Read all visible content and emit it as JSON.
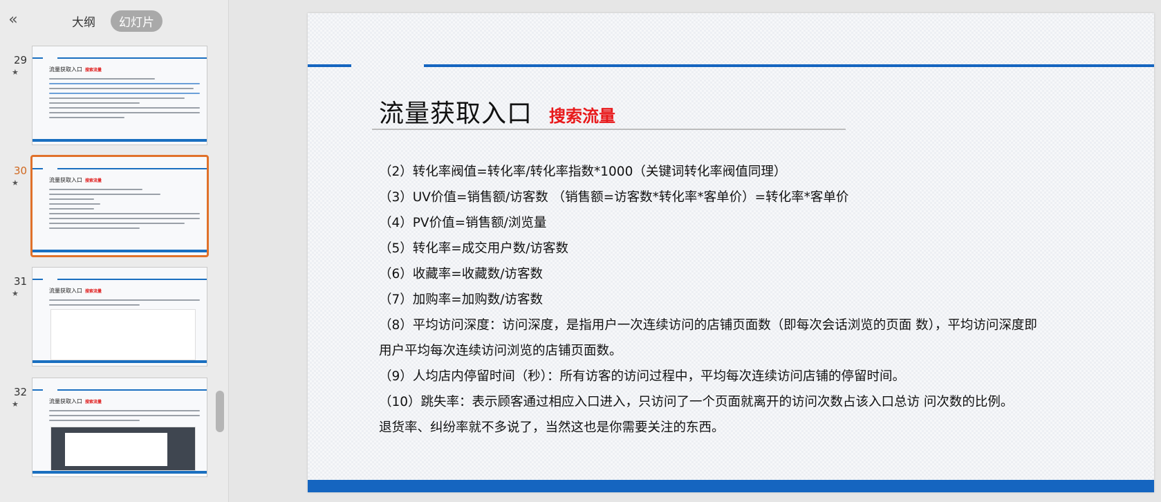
{
  "sidebar": {
    "collapse_icon": "double-chevron-left-icon",
    "collapse_glyph": "«",
    "tabs": [
      {
        "label": "大纲",
        "active": false
      },
      {
        "label": "幻灯片",
        "active": true
      }
    ],
    "star_glyph": "★",
    "thumbnails": [
      {
        "number": "29",
        "title": "流量获取入口",
        "subtitle": "搜索流量",
        "active": false
      },
      {
        "number": "30",
        "title": "流量获取入口",
        "subtitle": "搜索流量",
        "active": true
      },
      {
        "number": "31",
        "title": "流量获取入口",
        "subtitle": "搜索流量",
        "active": false
      },
      {
        "number": "32",
        "title": "流量获取入口",
        "subtitle": "搜索流量",
        "active": false
      }
    ]
  },
  "slide": {
    "title": "流量获取入口",
    "subtitle": "搜索流量",
    "lines": [
      "（2）转化率阀值=转化率/转化率指数*1000（关键词转化率阀值同理）",
      "（3）UV价值=销售额/访客数 （销售额=访客数*转化率*客单价）=转化率*客单价",
      "（4）PV价值=销售额/浏览量",
      "（5）转化率=成交用户数/访客数",
      "（6）收藏率=收藏数/访客数",
      "（7）加购率=加购数/访客数",
      "（8）平均访问深度：访问深度，是指用户一次连续访问的店铺页面数（即每次会话浏览的页面 数），平均访问深度即",
      "用户平均每次连续访问浏览的店铺页面数。",
      "（9）人均店内停留时间（秒）：所有访客的访问过程中，平均每次连续访问店铺的停留时间。",
      "（10）跳失率：表示顾客通过相应入口进入，只访问了一个页面就离开的访问次数占该入口总访 问次数的比例。",
      "退货率、纠纷率就不多说了，当然这也是你需要关注的东西。"
    ],
    "colors": {
      "accent_blue": "#1565c0",
      "subtitle_red": "#e8191b",
      "active_thumb_border": "#e0712a"
    }
  }
}
